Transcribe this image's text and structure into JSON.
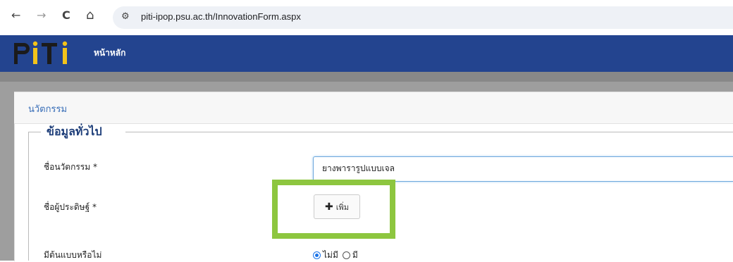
{
  "browser": {
    "back_icon": "←",
    "forward_icon": "→",
    "reload_icon": "C",
    "home_icon": "⌂",
    "site_info_icon": "⚙",
    "url": "piti-ipop.psu.ac.th/InnovationForm.aspx"
  },
  "header": {
    "logo_text": "PiTi",
    "nav_home": "หน้าหลัก",
    "bg_color": "#23448f"
  },
  "breadcrumb": "นวัตกรรม",
  "form": {
    "section_title": "ข้อมูลทั่วไป",
    "innovation_name_label": "ชื่อนวัตกรรม",
    "innovation_name_value": "ยางพารารูปแบบเจล",
    "inventor_label": "ชื่อผู้ประดิษฐ์",
    "add_button_label": "เพิ่ม",
    "add_icon": "✚",
    "prototype_label": "มีต้นแบบหรือไม่",
    "prototype_options": [
      "ไม่มี",
      "มี"
    ],
    "prototype_selected": "ไม่มี",
    "required_mark": "*"
  },
  "highlight_color": "#8dc63f"
}
